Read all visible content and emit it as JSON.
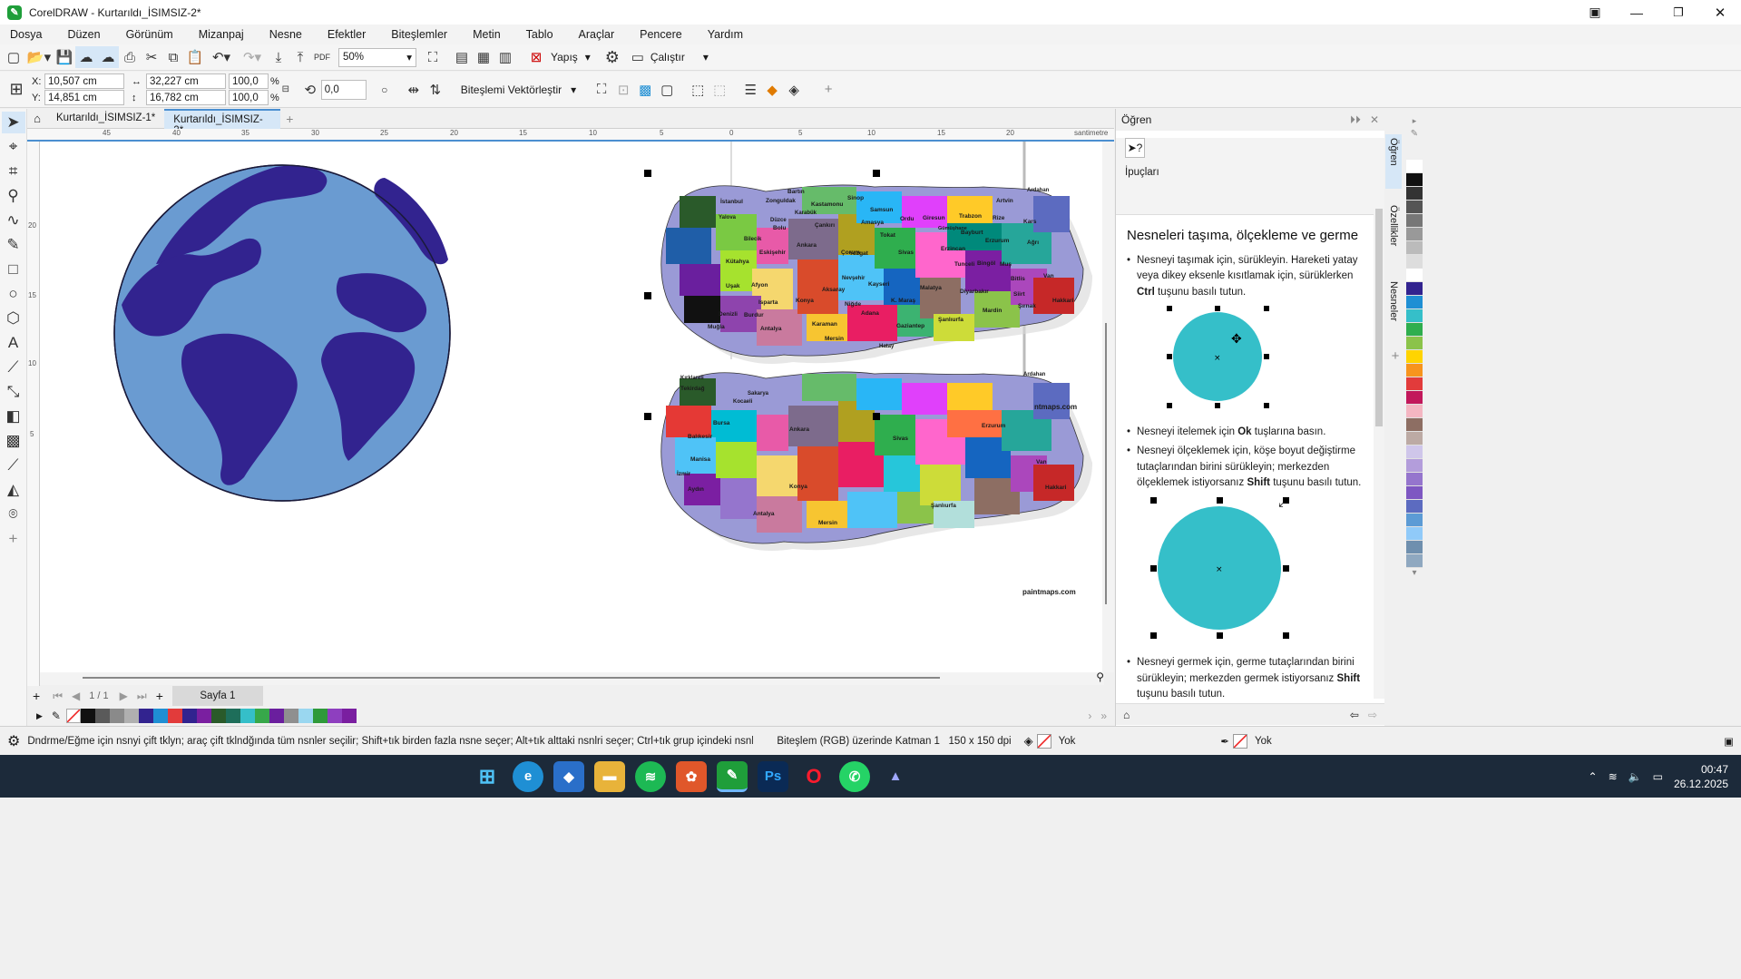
{
  "window": {
    "title": "CorelDRAW - Kurtarıldı_İSIMSIZ-2*"
  },
  "menu": [
    "Dosya",
    "Düzen",
    "Görünüm",
    "Mizanpaj",
    "Nesne",
    "Efektler",
    "Biteşlemler",
    "Metin",
    "Tablo",
    "Araçlar",
    "Pencere",
    "Yardım"
  ],
  "toolbar": {
    "zoom": "50%",
    "snap_label": "Yapış",
    "run_label": "Çalıştır"
  },
  "propbar": {
    "x": "10,507 cm",
    "y": "14,851 cm",
    "w": "32,227 cm",
    "h": "16,782 cm",
    "scale_w": "100,0",
    "scale_h": "100,0",
    "pct": "%",
    "rotation": "0,0",
    "trace_label": "Biteşlemi Vektörleştir",
    "x_label": "X:",
    "y_label": "Y:"
  },
  "tabs": [
    "Kurtarıldı_İSIMSIZ-1*",
    "Kurtarıldı_İSIMSIZ-2*"
  ],
  "ruler": {
    "h_ticks": [
      "45",
      "40",
      "35",
      "30",
      "25",
      "20",
      "15",
      "10",
      "5",
      "0",
      "5",
      "10",
      "15",
      "20"
    ],
    "unit": "santimetre",
    "v_ticks": [
      "20",
      "15",
      "10",
      "5"
    ]
  },
  "maps": {
    "labels_top": [
      "İstanbul",
      "Zonguldak",
      "Bartın",
      "Sinop",
      "Kastamonu",
      "Samsun",
      "Ordu",
      "Giresun",
      "Trabzon",
      "Rize",
      "Artvin",
      "Ardahan",
      "Kars",
      "Ağrı",
      "Van",
      "Hakkari",
      "Şırnak",
      "Siirt",
      "Bitlis",
      "Muş",
      "Bingöl",
      "Erzurum",
      "Tunceli",
      "Erzincan",
      "Bayburt",
      "Gümüşhane",
      "Tokat",
      "Amasya",
      "Çorum",
      "Çankırı",
      "Karabük",
      "Bolu",
      "Düzce",
      "Bilecik",
      "Eskişehir",
      "Ankara",
      "Kırıkkale",
      "Kırşehir",
      "Yozgat",
      "Sivas",
      "Malatya",
      "Elazığ",
      "Diyarbakır",
      "Mardin",
      "Şanlıurfa",
      "Adıyaman",
      "Gaziantep",
      "Kilis",
      "Hatay",
      "Osmaniye",
      "Adana",
      "K. Maraş",
      "Kayseri",
      "Nevşehir",
      "Niğde",
      "Aksaray",
      "Konya",
      "Karaman",
      "Mersin",
      "Antalya",
      "Isparta",
      "Afyon",
      "Kütahya",
      "Uşak",
      "Denizli",
      "Muğla",
      "Aydın",
      "İzmir",
      "Manisa",
      "Balıkesir",
      "Bursa",
      "Yalova",
      "Kocaeli",
      "Sakarya",
      "Tekirdağ",
      "Kırklareli",
      "Edirne",
      "Çanakkale",
      "Burdur"
    ],
    "watermark": "paintmaps.com",
    "watermark2": "ntmaps.com"
  },
  "panel": {
    "title": "Öğren",
    "tips_label": "İpuçları",
    "heading": "Nesneleri taşıma, ölçekleme ve germe",
    "b1_pre": "Nesneyi taşımak için, sürükleyin. Hareketi yatay veya dikey eksenle kısıtlamak için, sürüklerken ",
    "b1_key": "Ctrl",
    "b1_post": " tuşunu basılı tutun.",
    "b2_pre": "Nesneyi itelemek için ",
    "b2_key": "Ok",
    "b2_post": " tuşlarına basın.",
    "b3_pre": "Nesneyi ölçeklemek için, köşe boyut değiştirme tutaçlarından birini sürükleyin; merkezden ölçeklemek istiyorsanız ",
    "b3_key": "Shift",
    "b3_post": " tuşunu basılı tutun.",
    "b4_pre": "Nesneyi germek için, germe tutaçlarından birini sürükleyin; merkezden germek istiyorsanız ",
    "b4_key": "Shift",
    "b4_post": " tuşunu basılı tutun.",
    "side_tabs": [
      "Öğren",
      "Özellikler",
      "Nesneler"
    ]
  },
  "pagebar": {
    "page_count": "1 / 1",
    "page_name": "Sayfa 1"
  },
  "status": {
    "hint": "Dndrme/Eğme için nsnyi çift tklyn; araç çift tklndğında tüm nsnler seçilir; Shift+tık birden fazla nsne seçer; Alt+tık alttaki nsnlri seçer; Ctrl+tık grup içindeki nsnlri seçer",
    "layer": "Biteşlem (RGB) üzerinde Katman 1   150 x 150 dpi",
    "fill": "Yok",
    "outline": "Yok"
  },
  "clock": {
    "time": "00:47",
    "date": "26.12.2025"
  },
  "colors": {
    "globe_ocean": "#6a9bd1",
    "globe_land": "#32238f",
    "accent": "#4b8fd0",
    "circle": "#35bfc9"
  },
  "palette": [
    "#111111",
    "#5a5a5a",
    "#8a8a8a",
    "#b0b0b0",
    "#32238f",
    "#1f8fd4",
    "#e23b3b",
    "#32238f",
    "#7a1fa0",
    "#2a5a2a",
    "#1e6e5a",
    "#35bfc9",
    "#37a84a",
    "#6a1f9e",
    "#8f8f8f",
    "#9ad7f0",
    "#2f9a3a",
    "#8e3fbf",
    "#7a1fa0"
  ],
  "strip": [
    "#ffffff",
    "#111111",
    "#333333",
    "#555555",
    "#777777",
    "#999999",
    "#bbbbbb",
    "#dddddd",
    "#ffffff",
    "#32238f",
    "#1f8fd4",
    "#35bfc9",
    "#2fae4e",
    "#8bc34a",
    "#ffd400",
    "#f7941d",
    "#e23b3b",
    "#c2185b",
    "#f4b6c2",
    "#8d6e63",
    "#bcaaa4",
    "#cfc6ea",
    "#b39ddb",
    "#9575cd",
    "#7e57c2",
    "#5c6bc0",
    "#5c9bd5",
    "#90caf9",
    "#6f8fae",
    "#8fa8c0"
  ]
}
